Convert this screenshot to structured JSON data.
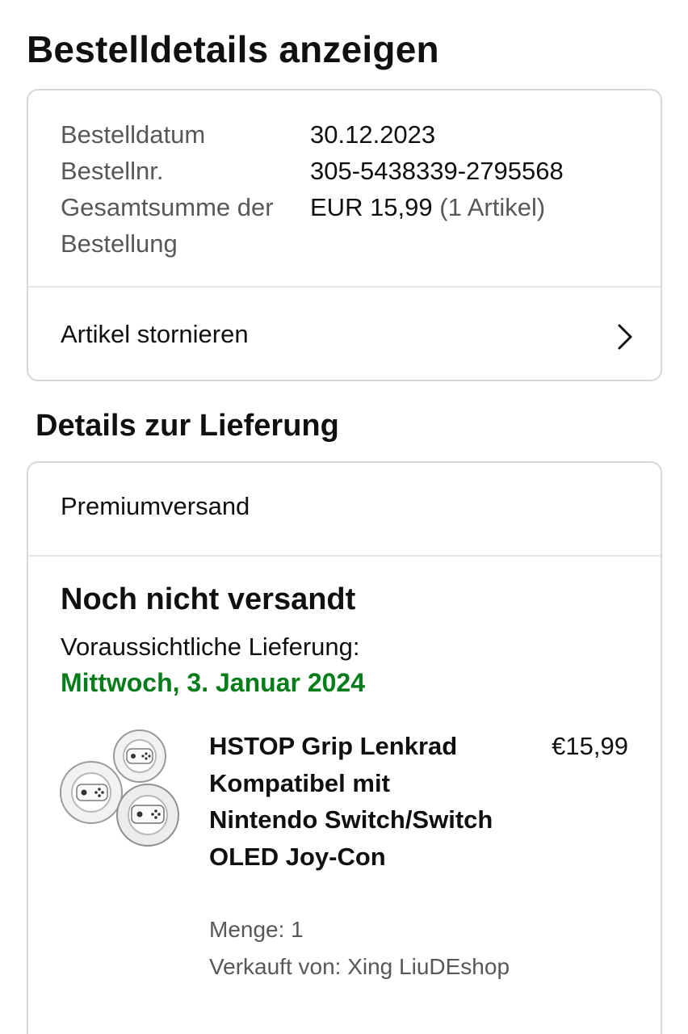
{
  "page": {
    "title": "Bestelldetails anzeigen"
  },
  "order": {
    "date_label": "Bestelldatum",
    "date_value": "30.12.2023",
    "number_label": "Bestellnr.",
    "number_value": "305-5438339-2795568",
    "total_label": "Gesamtsumme der Bestellung",
    "total_value": "EUR 15,99",
    "total_items": "(1 Artikel)",
    "cancel_label": "Artikel stornieren",
    "cancel_icon": "chevron-right-icon"
  },
  "delivery": {
    "section_title": "Details zur Lieferung",
    "shipping_method": "Premiumversand",
    "status": "Noch nicht versandt",
    "expected_label": "Voraussichtliche Lieferung:",
    "expected_date": "Mittwoch, 3. Januar 2024",
    "accent_color": "#067d1a"
  },
  "product": {
    "title": "HSTOP Grip Lenkrad Kompatibel mit Nintendo Switch/Switch OLED Joy-Con",
    "price": "€15,99",
    "quantity": "Menge: 1",
    "seller": "Verkauft von: Xing LiuDEshop",
    "image": "white-steering-wheel-grips-image"
  }
}
